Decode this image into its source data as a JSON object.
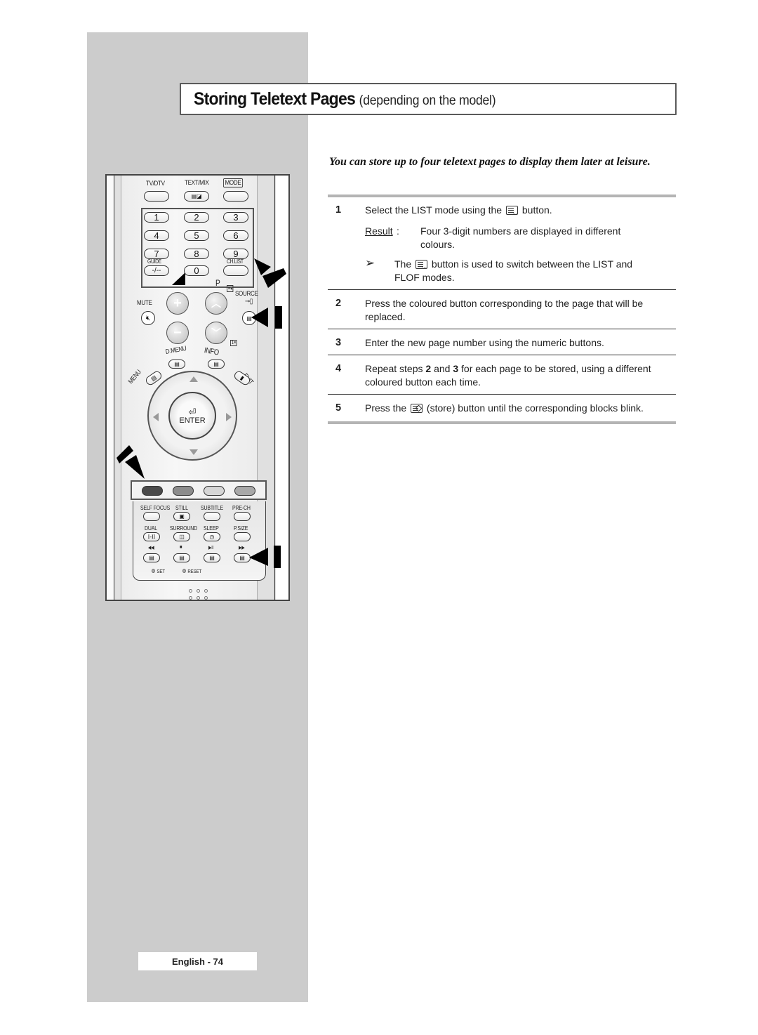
{
  "page": {
    "title_main": "Storing Teletext Pages",
    "title_sub": "(depending on the model)",
    "intro": "You can store up to four teletext pages to display them later at leisure.",
    "footer": "English - 74"
  },
  "steps": [
    {
      "number": "1",
      "text_before_icon": "Select the LIST mode using the",
      "icon": "list-button-icon",
      "text_after_icon": "button.",
      "result_label": "Result",
      "result_text": "Four 3-digit numbers are displayed in different colours.",
      "note_arrow": "➢",
      "note_before_icon": "The",
      "note_icon": "list-button-icon",
      "note_after_icon": "button is used to switch between the LIST and FLOF modes."
    },
    {
      "number": "2",
      "text": "Press the coloured button corresponding to the page that will be replaced."
    },
    {
      "number": "3",
      "text": "Enter the new page number using the numeric buttons."
    },
    {
      "number": "4",
      "text_a": "Repeat steps",
      "bold_a": "2",
      "text_b": "and",
      "bold_b": "3",
      "text_c": "for each page to be stored, using a different coloured button each time."
    },
    {
      "number": "5",
      "text_before_icon": "Press the",
      "icon": "store-button-icon",
      "text_after_icon": "(store) button until the corresponding blocks blink."
    }
  ],
  "remote": {
    "top_labels": [
      "TV/DTV",
      "TEXT/MIX",
      "MODE"
    ],
    "numbers": [
      "1",
      "2",
      "3",
      "4",
      "5",
      "6",
      "7",
      "8",
      "9",
      "0"
    ],
    "guide_label": "GUIDE",
    "dash_label": "-/--",
    "chlist_label": "CH.LIST",
    "p_label": "P",
    "source_label": "SOURCE",
    "mute_label": "MUTE",
    "dmenu_label": "D.MENU",
    "info_label": "INFO",
    "menu_label": "MENU",
    "exit_label": "EXIT",
    "enter_label": "ENTER",
    "color_buttons": [
      {
        "name": "red",
        "color": "#4a4a4a"
      },
      {
        "name": "green",
        "color": "#8c8c8c"
      },
      {
        "name": "yellow",
        "color": "#d6d6d6"
      },
      {
        "name": "blue",
        "color": "#a8a8a8"
      }
    ],
    "lower_row1": [
      "SELF FOCUS",
      "STILL",
      "SUBTITLE",
      "PRE-CH"
    ],
    "lower_row2": [
      "DUAL",
      "SURROUND",
      "SLEEP",
      "P.SIZE"
    ],
    "dual_glyph": "I-II",
    "transport": [
      "◀◀",
      "■",
      "▶II",
      "▶▶"
    ],
    "set_label": "SET",
    "reset_label": "RESET"
  },
  "colors": {
    "panel_grey": "#cccccc",
    "rule_grey": "#b4b4b4",
    "title_border": "#5a5a5a"
  }
}
